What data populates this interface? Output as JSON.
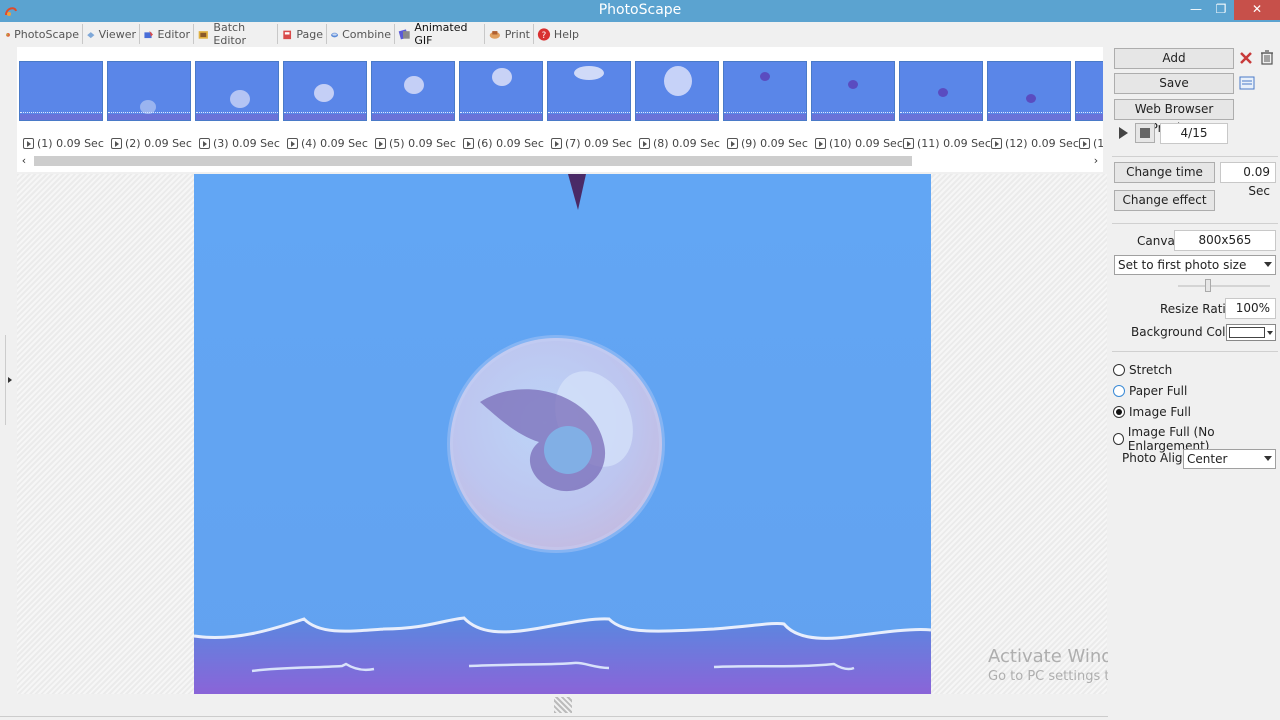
{
  "window": {
    "title": "PhotoScape"
  },
  "menu": [
    {
      "label": "PhotoScape",
      "icon": "photoscape-icon"
    },
    {
      "label": "Viewer",
      "icon": "viewer-icon"
    },
    {
      "label": "Editor",
      "icon": "editor-icon"
    },
    {
      "label": "Batch Editor",
      "icon": "batch-editor-icon"
    },
    {
      "label": "Page",
      "icon": "page-icon"
    },
    {
      "label": "Combine",
      "icon": "combine-icon"
    },
    {
      "label": "Animated GIF",
      "icon": "animated-gif-icon",
      "active": true
    },
    {
      "label": "Print",
      "icon": "print-icon"
    },
    {
      "label": "Help",
      "icon": "help-icon"
    }
  ],
  "frames": [
    {
      "label": "(1) 0.09 Sec"
    },
    {
      "label": "(2) 0.09 Sec"
    },
    {
      "label": "(3) 0.09 Sec"
    },
    {
      "label": "(4) 0.09 Sec"
    },
    {
      "label": "(5) 0.09 Sec"
    },
    {
      "label": "(6) 0.09 Sec"
    },
    {
      "label": "(7) 0.09 Sec"
    },
    {
      "label": "(8) 0.09 Sec"
    },
    {
      "label": "(9) 0.09 Sec"
    },
    {
      "label": "(10) 0.09 Sec"
    },
    {
      "label": "(11) 0.09 Sec"
    },
    {
      "label": "(12) 0.09 Sec"
    },
    {
      "label": "(1"
    }
  ],
  "panel": {
    "add": "Add",
    "save": "Save",
    "web_preview": "Web Browser Preview",
    "frame_counter": "4/15",
    "change_time": "Change time",
    "time_value": "0.09 Sec",
    "change_effect": "Change effect",
    "canvas_label": "Canvas",
    "canvas_value": "800x565",
    "size_mode": "Set to first photo size",
    "resize_label": "Resize Ratio",
    "resize_value": "100%",
    "bg_label": "Background Color",
    "bg_color": "#ffffff",
    "fit_options": [
      {
        "label": "Stretch",
        "selected": false
      },
      {
        "label": "Paper Full",
        "selected": false
      },
      {
        "label": "Image Full",
        "selected": true
      },
      {
        "label": "Image Full (No Enlargement)",
        "selected": false
      }
    ],
    "align_label": "Photo Align",
    "align_value": "Center"
  },
  "watermark": {
    "line1": "Activate Windows",
    "line2": "Go to PC settings to activate Windows."
  },
  "colors": {
    "titlebar": "#5ba3d0",
    "sky": "#64a4f2",
    "sea": "#5c70d8"
  }
}
